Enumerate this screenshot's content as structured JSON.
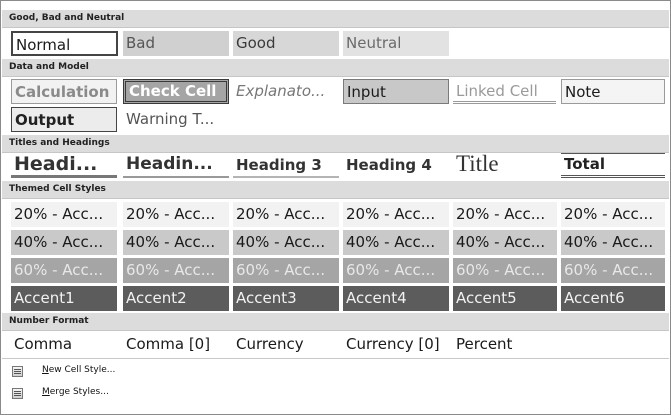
{
  "sections": {
    "good_bad_neutral": "Good, Bad and Neutral",
    "data_model": "Data and Model",
    "titles_headings": "Titles and Headings",
    "themed": "Themed Cell Styles",
    "number_format": "Number Format"
  },
  "cells": {
    "normal": "Normal",
    "bad": "Bad",
    "good": "Good",
    "neutral": "Neutral",
    "calculation": "Calculation",
    "check_cell": "Check Cell",
    "explanatory": "Explanato...",
    "input": "Input",
    "linked_cell": "Linked Cell",
    "note": "Note",
    "output": "Output",
    "warning": "Warning T...",
    "heading1": "Headi...",
    "heading2": "Headin...",
    "heading3": "Heading 3",
    "heading4": "Heading 4",
    "title": "Title",
    "total": "Total",
    "comma": "Comma",
    "comma0": "Comma [0]",
    "currency": "Currency",
    "currency0": "Currency [0]",
    "percent": "Percent"
  },
  "themed": {
    "row20": [
      "20% - Acc...",
      "20% - Acc...",
      "20% - Acc...",
      "20% - Acc...",
      "20% - Acc...",
      "20% - Acc..."
    ],
    "row40": [
      "40% - Acc...",
      "40% - Acc...",
      "40% - Acc...",
      "40% - Acc...",
      "40% - Acc...",
      "40% - Acc..."
    ],
    "row60": [
      "60% - Acc...",
      "60% - Acc...",
      "60% - Acc...",
      "60% - Acc...",
      "60% - Acc...",
      "60% - Acc..."
    ],
    "accents": [
      "Accent1",
      "Accent2",
      "Accent3",
      "Accent4",
      "Accent5",
      "Accent6"
    ]
  },
  "menu": {
    "new_cell_style": "New Cell Style...",
    "merge_styles": "Merge Styles..."
  },
  "icons": {
    "new_cell_style": "new-style-icon",
    "merge_styles": "merge-styles-icon"
  }
}
